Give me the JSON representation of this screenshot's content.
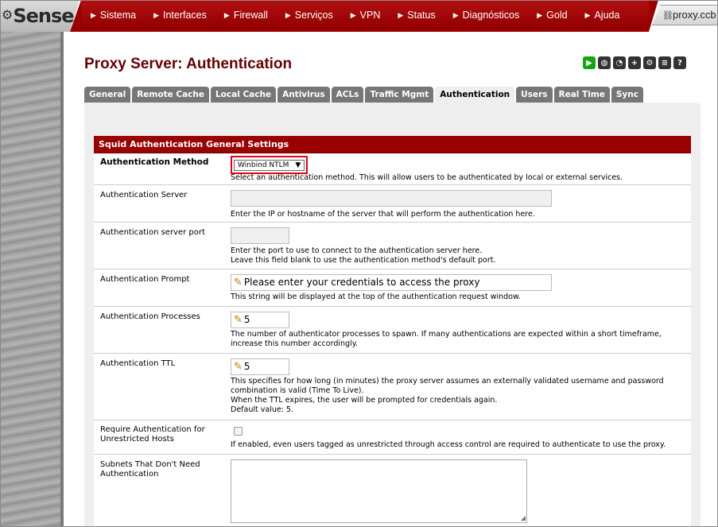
{
  "nav": {
    "logo": "Sense",
    "items": [
      "Sistema",
      "Interfaces",
      "Firewall",
      "Serviços",
      "VPN",
      "Status",
      "Diagnósticos",
      "Gold",
      "Ajuda"
    ],
    "hostname": "proxy.ccb"
  },
  "page": {
    "title": "Proxy Server: Authentication",
    "title_icons": [
      "play-icon",
      "globe-icon",
      "chart-icon",
      "add-icon",
      "gear-icon",
      "list-icon",
      "help-icon"
    ]
  },
  "tabs": [
    "General",
    "Remote Cache",
    "Local Cache",
    "Antivirus",
    "ACLs",
    "Traffic Mgmt",
    "Authentication",
    "Users",
    "Real Time",
    "Sync"
  ],
  "active_tab": "Authentication",
  "section": {
    "title": "Squid Authentication General Settings"
  },
  "fields": {
    "auth_method": {
      "label": "Authentication Method",
      "value": "Winbind NTLM",
      "desc": "Select an authentication method. This will allow users to be authenticated by local or external services."
    },
    "auth_server": {
      "label": "Authentication Server",
      "value": "",
      "desc": "Enter the IP or hostname of the server that will perform the authentication here."
    },
    "auth_port": {
      "label": "Authentication server port",
      "value": "",
      "desc1": "Enter the port to use to connect to the authentication server here.",
      "desc2": "Leave this field blank to use the authentication method's default port."
    },
    "auth_prompt": {
      "label": "Authentication Prompt",
      "value": "Please enter your credentials to access the proxy",
      "desc": "This string will be displayed at the top of the authentication request window."
    },
    "auth_processes": {
      "label": "Authentication Processes",
      "value": "5",
      "desc": "The number of authenticator processes to spawn. If many authentications are expected within a short timeframe, increase this number accordingly."
    },
    "auth_ttl": {
      "label": "Authentication TTL",
      "value": "5",
      "desc1": "This specifies for how long (in minutes) the proxy server assumes an externally validated username and password combination is valid (Time To Live).",
      "desc2": "When the TTL expires, the user will be prompted for credentials again.",
      "desc3": "Default value: 5."
    },
    "require_auth": {
      "label": "Require Authentication for Unrestricted Hosts",
      "checked": false,
      "desc": "If enabled, even users tagged as unrestricted through access control are required to authenticate to use the proxy."
    },
    "subnets": {
      "label": "Subnets That Don't Need Authentication",
      "value": ""
    }
  }
}
